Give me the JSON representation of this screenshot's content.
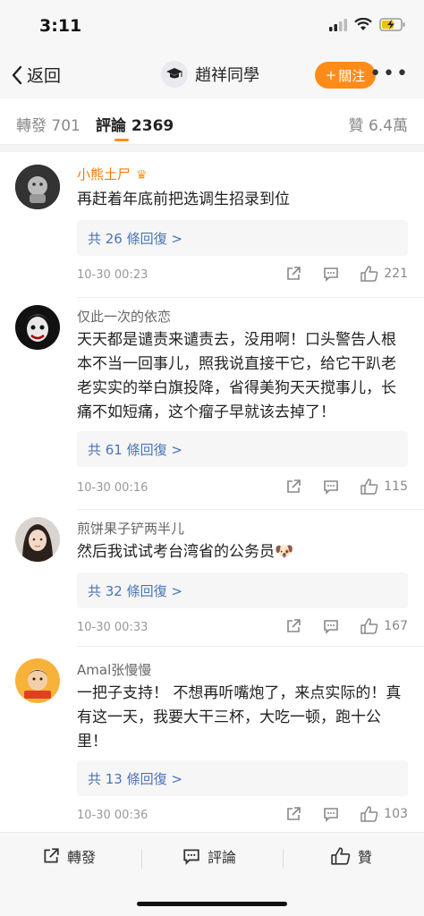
{
  "status": {
    "time": "3:11"
  },
  "nav": {
    "back_label": "返回",
    "title": "趙祥同學",
    "follow_label": "關注",
    "follow_plus": "+",
    "more": "•••"
  },
  "tabs": {
    "repost": "轉發 701",
    "comments": "評論 2369",
    "likes": "贊 6.4萬"
  },
  "colors": {
    "accent": "#ff8c1a",
    "link": "#4a74b8",
    "vip_name": "#ff7a00"
  },
  "comments": [
    {
      "user": "小熊土尸",
      "vip": true,
      "text": "再赶着年底前把选调生招录到位",
      "reply_label": "共 26 條回復 >",
      "date": "10-30 00:23",
      "likes": "221"
    },
    {
      "user": "仅此一次的依恋",
      "vip": false,
      "text": "天天都是谴责来谴责去，没用啊！口头警告人根本不当一回事儿，照我说直接干它，给它干趴老老实实的举白旗投降，省得美狗天天搅事儿，长痛不如短痛，这个瘤子早就该去掉了！",
      "reply_label": "共 61 條回復 >",
      "date": "10-30 00:16",
      "likes": "115"
    },
    {
      "user": "煎饼果子铲两半儿",
      "vip": false,
      "text": "然后我试试考台湾省的公务员🐶",
      "reply_label": "共 32 條回復 >",
      "date": "10-30 00:33",
      "likes": "167"
    },
    {
      "user": "Amal张慢慢",
      "vip": false,
      "text": "一把子支持！ 不想再听嘴炮了，来点实际的！真有这一天，我要大干三杯，大吃一顿，跑十公里！",
      "reply_label": "共 13 條回復 >",
      "date": "10-30 00:36",
      "likes": "103"
    }
  ],
  "bottom": {
    "repost": "轉發",
    "comment": "評論",
    "like": "贊"
  }
}
